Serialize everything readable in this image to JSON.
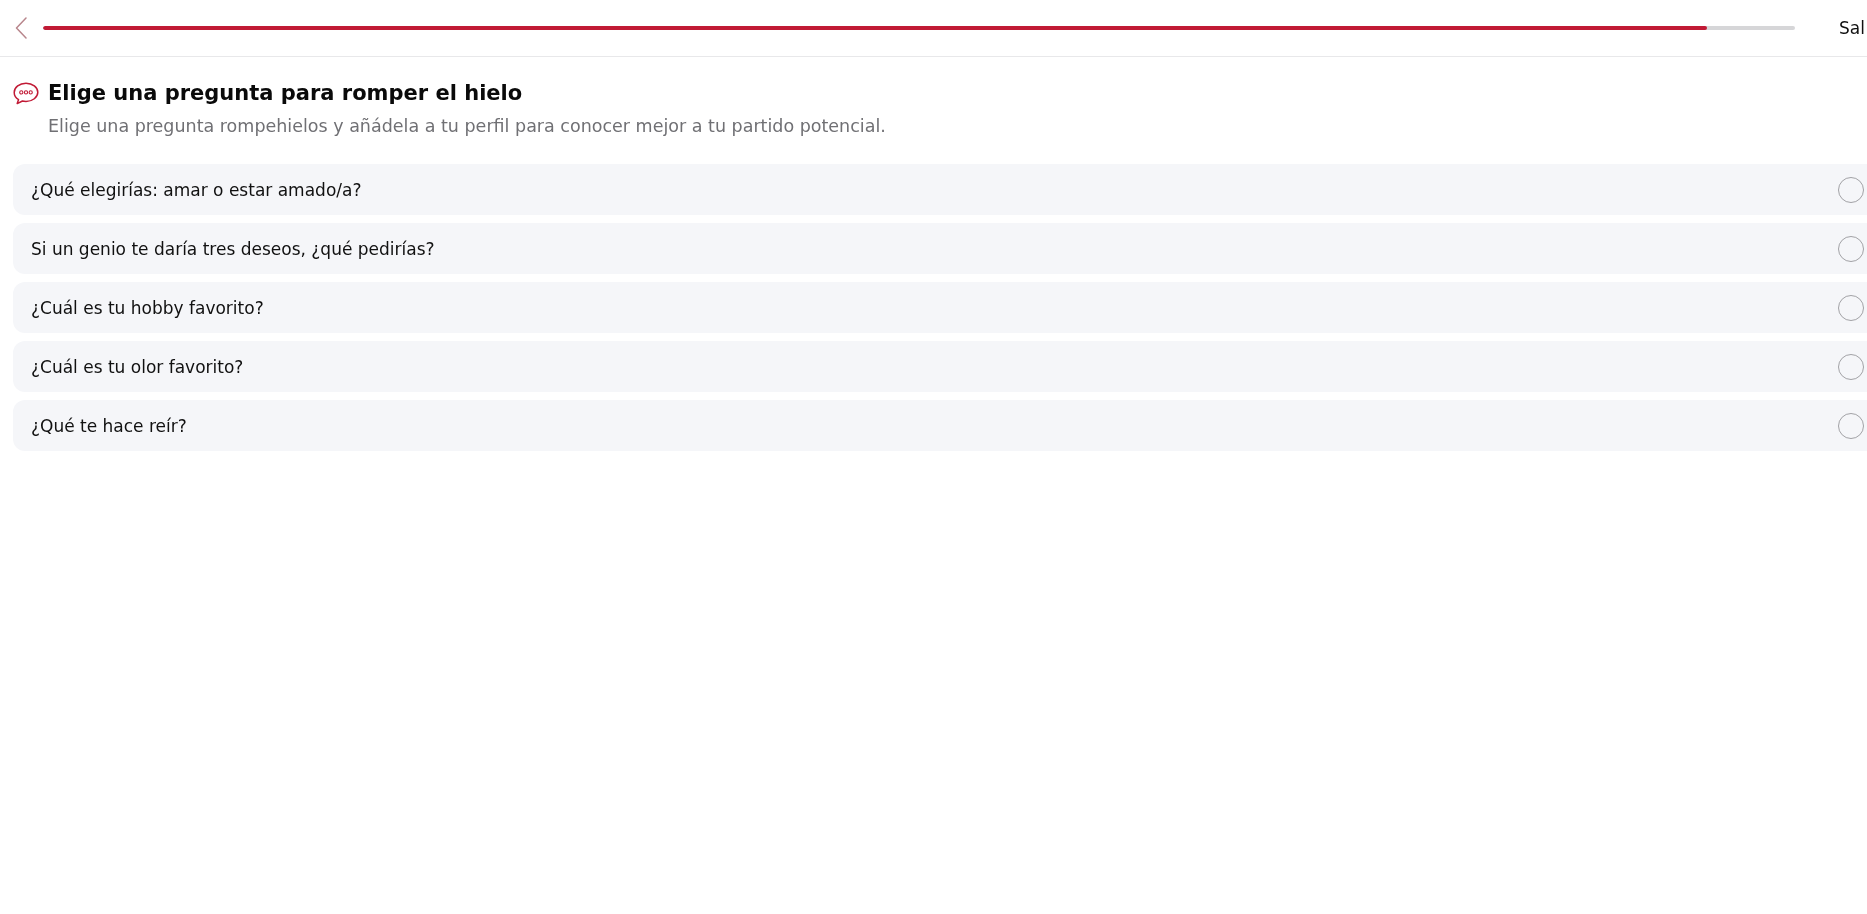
{
  "header": {
    "progress": {
      "level": 0.95
    },
    "exit_label": "Sal"
  },
  "section": {
    "title": "Elige una pregunta para romper el hielo",
    "subtitle": "Elige una pregunta rompehielos y añádela a tu perfil para conocer mejor a tu partido potencial."
  },
  "questions": [
    {
      "text": "¿Qué elegirías: amar o estar amado/a?",
      "selected": false
    },
    {
      "text": "Si un genio te daría tres deseos, ¿qué pedirías?",
      "selected": false
    },
    {
      "text": "¿Cuál es tu hobby favorito?",
      "selected": false
    },
    {
      "text": "¿Cuál es tu olor favorito?",
      "selected": false
    },
    {
      "text": "¿Qué te hace reír?",
      "selected": false
    }
  ]
}
